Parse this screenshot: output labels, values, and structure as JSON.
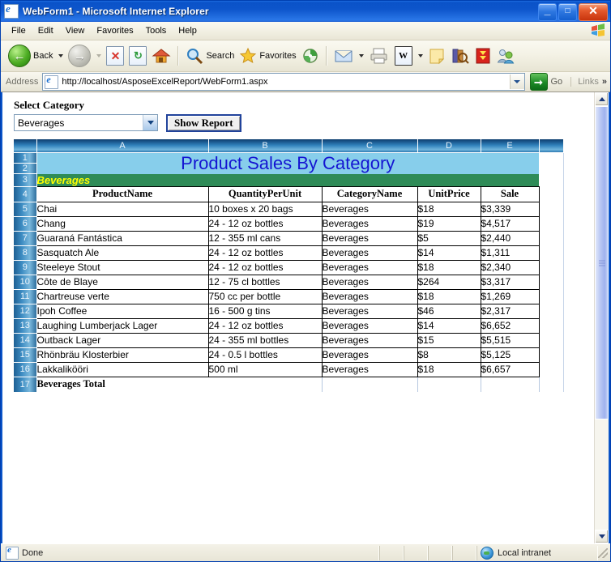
{
  "window": {
    "title": "WebForm1 - Microsoft Internet Explorer",
    "icon": "ie-document-icon",
    "buttons": {
      "minimize": "_",
      "maximize": "□",
      "close": "✕"
    }
  },
  "menu": {
    "items": [
      "File",
      "Edit",
      "View",
      "Favorites",
      "Tools",
      "Help"
    ]
  },
  "toolbar": {
    "back_label": "Back",
    "search_label": "Search",
    "favorites_label": "Favorites",
    "icons": [
      "back-arrow-icon",
      "forward-arrow-icon",
      "stop-icon",
      "refresh-icon",
      "home-icon",
      "search-icon",
      "favorites-star-icon",
      "history-icon",
      "mail-icon",
      "print-icon",
      "edit-word-icon",
      "notes-icon",
      "research-icon",
      "download-icon",
      "messenger-icon"
    ]
  },
  "address": {
    "label": "Address",
    "url": "http://localhost/AsposeExcelReport/WebForm1.aspx",
    "go_label": "Go",
    "links_label": "Links",
    "overflow": "»"
  },
  "form": {
    "select_label": "Select Category",
    "category_value": "Beverages",
    "button_label": "Show Report"
  },
  "sheet": {
    "column_headers": [
      "A",
      "B",
      "C",
      "D",
      "E",
      ""
    ],
    "row_numbers": [
      1,
      2,
      3,
      4,
      5,
      6,
      7,
      8,
      9,
      10,
      11,
      12,
      13,
      14,
      15,
      16,
      17
    ],
    "title": "Product Sales By Category",
    "category_band": "Beverages",
    "headers": [
      "ProductName",
      "QuantityPerUnit",
      "CategoryName",
      "UnitPrice",
      "Sale"
    ],
    "rows": [
      [
        "Chai",
        "10 boxes x 20 bags",
        "Beverages",
        "$18",
        "$3,339"
      ],
      [
        "Chang",
        "24 - 12 oz bottles",
        "Beverages",
        "$19",
        "$4,517"
      ],
      [
        "Guaraná Fantástica",
        "12 - 355 ml cans",
        "Beverages",
        "$5",
        "$2,440"
      ],
      [
        "Sasquatch Ale",
        "24 - 12 oz bottles",
        "Beverages",
        "$14",
        "$1,311"
      ],
      [
        "Steeleye Stout",
        "24 - 12 oz bottles",
        "Beverages",
        "$18",
        "$2,340"
      ],
      [
        "Côte de Blaye",
        "12 - 75 cl bottles",
        "Beverages",
        "$264",
        "$3,317"
      ],
      [
        "Chartreuse verte",
        "750 cc per bottle",
        "Beverages",
        "$18",
        "$1,269"
      ],
      [
        "Ipoh Coffee",
        "16 - 500 g tins",
        "Beverages",
        "$46",
        "$2,317"
      ],
      [
        "Laughing Lumberjack Lager",
        "24 - 12 oz bottles",
        "Beverages",
        "$14",
        "$6,652"
      ],
      [
        "Outback Lager",
        "24 - 355 ml bottles",
        "Beverages",
        "$15",
        "$5,515"
      ],
      [
        "Rhönbräu Klosterbier",
        "24 - 0.5 l bottles",
        "Beverages",
        "$8",
        "$5,125"
      ],
      [
        "Lakkalikööri",
        "500 ml",
        "Beverages",
        "$18",
        "$6,657"
      ]
    ],
    "total_label": "Beverages Total"
  },
  "status": {
    "message": "Done",
    "zone": "Local intranet"
  },
  "colors": {
    "titlebar": "#0a54c8",
    "sheet_title_bg": "#87ceeb",
    "sheet_title_fg": "#1414d2",
    "band_bg": "#2e8b57",
    "band_fg": "#ffff00",
    "header_blue": "#2e7fba"
  }
}
